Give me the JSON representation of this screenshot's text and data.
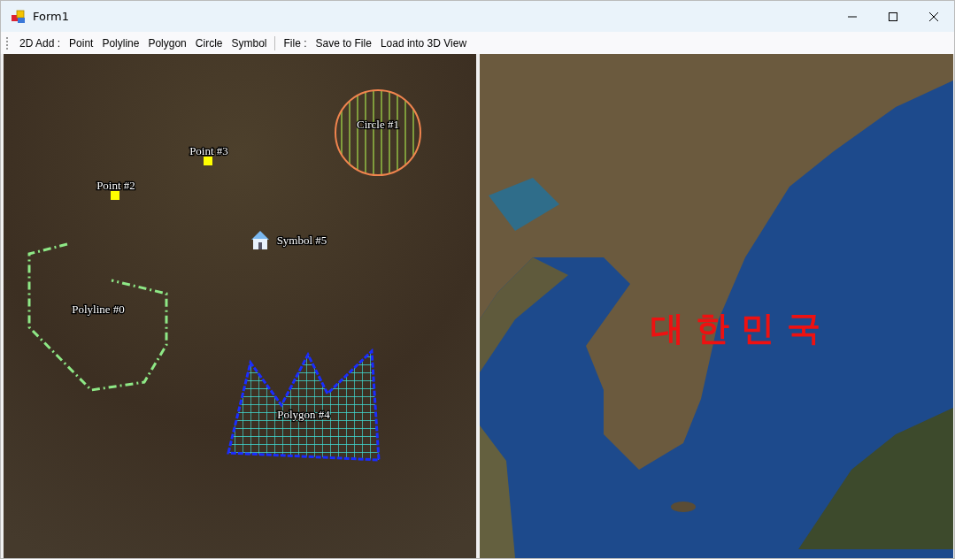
{
  "window": {
    "title": "Form1"
  },
  "toolbar": [
    {
      "kind": "label",
      "text": "2D Add :"
    },
    {
      "kind": "button",
      "text": "Point"
    },
    {
      "kind": "button",
      "text": "Polyline"
    },
    {
      "kind": "button",
      "text": "Polygon"
    },
    {
      "kind": "button",
      "text": "Circle"
    },
    {
      "kind": "button",
      "text": "Symbol"
    },
    {
      "kind": "separator"
    },
    {
      "kind": "label",
      "text": "File :"
    },
    {
      "kind": "button",
      "text": "Save to File"
    },
    {
      "kind": "button",
      "text": "Load into 3D View"
    }
  ],
  "map_2d": {
    "features": [
      {
        "kind": "polyline",
        "label": "Polyline #0"
      },
      {
        "kind": "circle",
        "label": "Circle #1"
      },
      {
        "kind": "point",
        "label": "Point #2"
      },
      {
        "kind": "point",
        "label": "Point #3"
      },
      {
        "kind": "polygon",
        "label": "Polygon #4"
      },
      {
        "kind": "symbol",
        "label": "Symbol #5"
      }
    ]
  },
  "map_3d": {
    "label": "대 한 민 국"
  }
}
